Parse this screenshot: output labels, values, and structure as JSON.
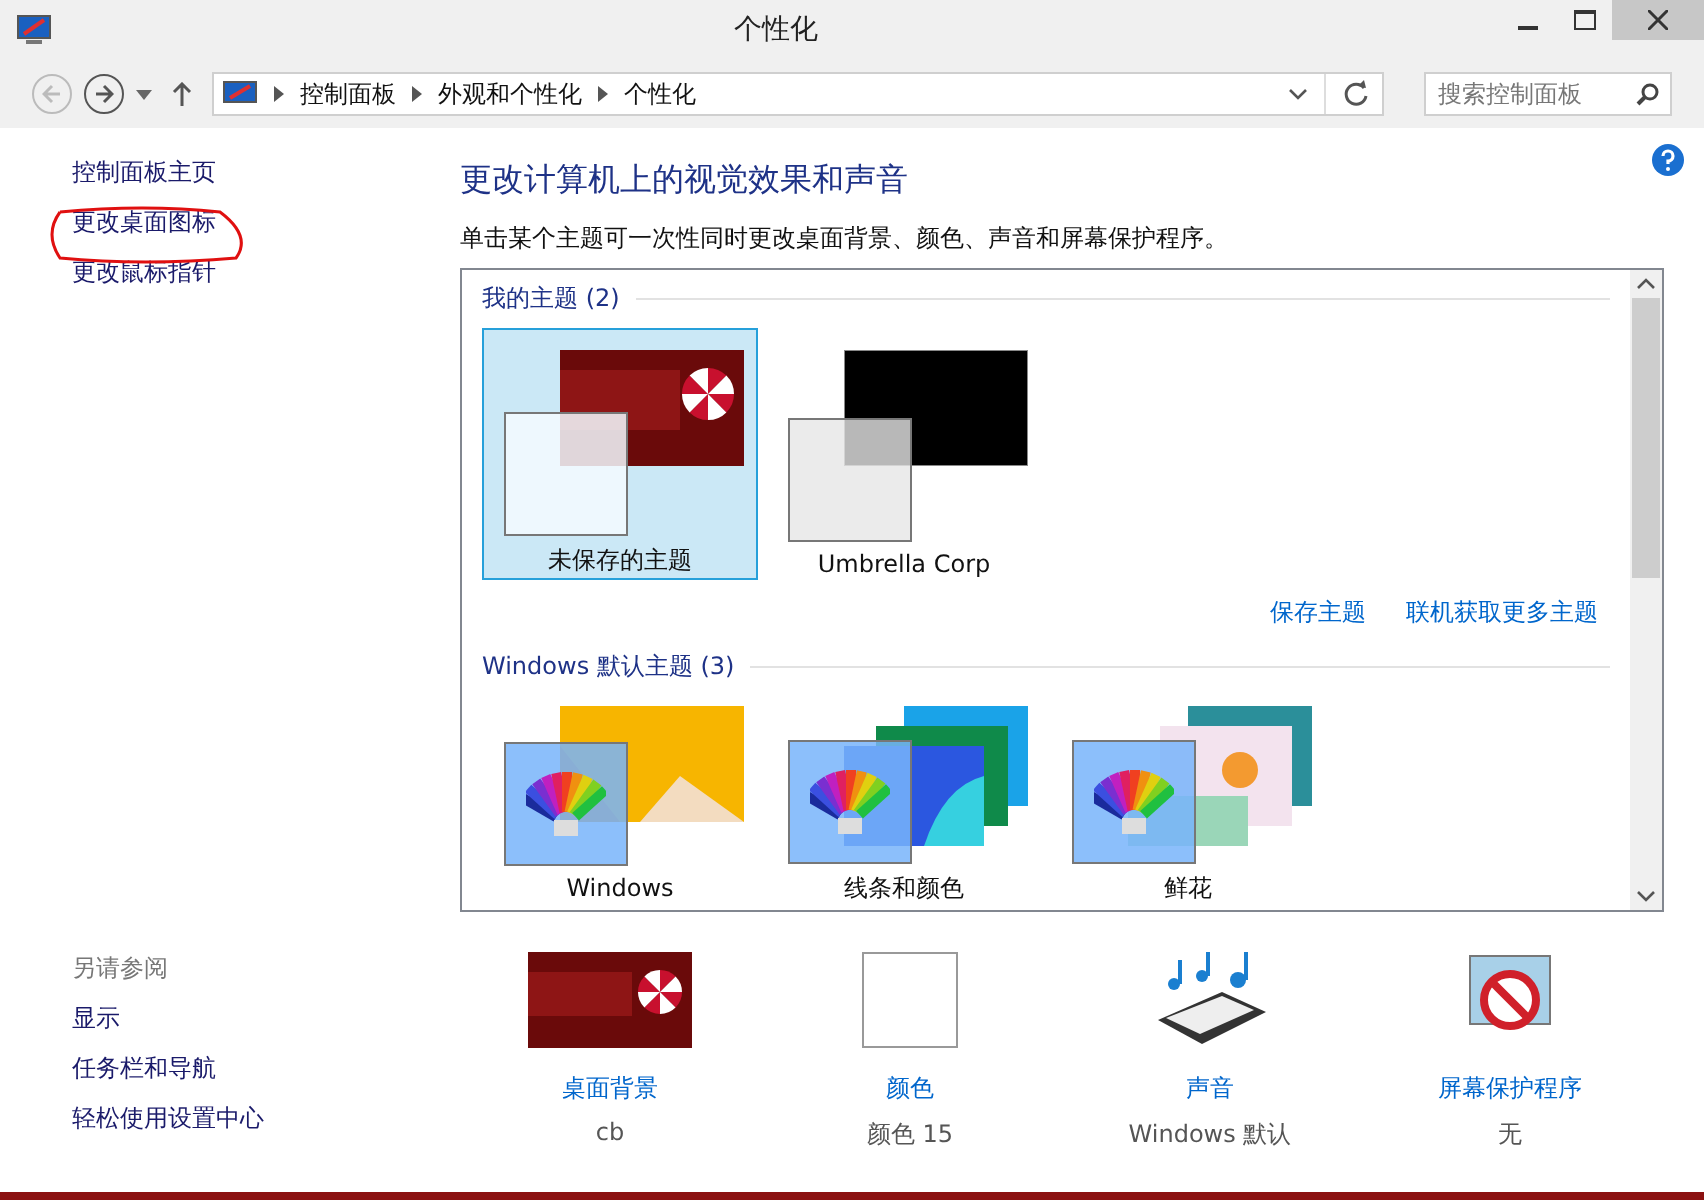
{
  "window": {
    "title": "个性化"
  },
  "address": {
    "path": [
      "控制面板",
      "外观和个性化",
      "个性化"
    ],
    "search": {
      "placeholder": "搜索控制面板"
    }
  },
  "sidebar": {
    "links": [
      "控制面板主页",
      "更改桌面图标",
      "更改鼠标指针"
    ],
    "see_also": {
      "title": "另请参阅",
      "links": [
        "显示",
        "任务栏和导航",
        "轻松使用设置中心"
      ]
    }
  },
  "main": {
    "heading": "更改计算机上的视觉效果和声音",
    "description": "单击某个主题可一次性同时更改桌面背景、颜色、声音和屏幕保护程序。"
  },
  "groups": [
    {
      "title": "我的主题",
      "count": "(2)",
      "themes": [
        {
          "name": "未保存的主题",
          "kind": "umbrella",
          "selected": true
        },
        {
          "name": "Umbrella Corp",
          "kind": "black",
          "selected": false
        }
      ],
      "actions": [
        "保存主题",
        "联机获取更多主题"
      ]
    },
    {
      "title": "Windows 默认主题",
      "count": "(3)",
      "themes": [
        {
          "name": "Windows",
          "kind": "orange",
          "selected": false
        },
        {
          "name": "线条和颜色",
          "kind": "lines",
          "selected": false
        },
        {
          "name": "鲜花",
          "kind": "flowers",
          "selected": false
        }
      ]
    }
  ],
  "settings": [
    {
      "kind": "background",
      "label": "桌面背景",
      "value": "cb"
    },
    {
      "kind": "color",
      "label": "颜色",
      "value": "颜色 15"
    },
    {
      "kind": "sound",
      "label": "声音",
      "value": "Windows 默认"
    },
    {
      "kind": "screensaver",
      "label": "屏幕保护程序",
      "value": "无"
    }
  ]
}
